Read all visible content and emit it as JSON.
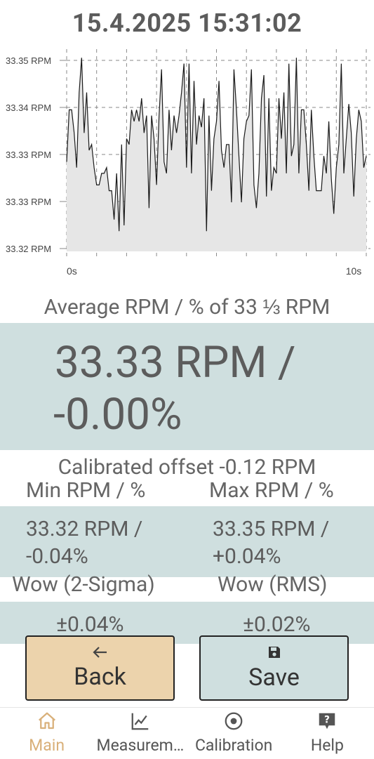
{
  "header": {
    "timestamp": "15.4.2025 15:31:02"
  },
  "chart_data": {
    "type": "area",
    "title": "",
    "xlabel": "",
    "ylabel": "",
    "x_tick_labels": [
      "0s",
      "10s"
    ],
    "xlim": [
      0,
      10
    ],
    "y_tick_labels": [
      "33.35 RPM",
      "33.34 RPM",
      "33.33 RPM",
      "33.33 RPM",
      "33.32 RPM"
    ],
    "ylim": [
      33.3165,
      33.3515
    ],
    "grid": true,
    "colors": {
      "line": "#1a1a1a",
      "fill": "#e6e6e6",
      "grid": "#8a8a8a"
    },
    "series": [
      {
        "values": [
          33.332,
          33.341,
          33.341,
          33.337,
          33.331,
          33.344,
          33.35,
          33.337,
          33.344,
          33.334,
          33.335,
          33.331,
          33.328,
          33.328,
          33.33,
          33.33,
          33.331,
          33.327,
          33.327,
          33.322,
          33.33,
          33.32,
          33.335,
          33.321,
          33.336,
          33.335,
          33.341,
          33.339,
          33.341,
          33.339,
          33.343,
          33.337,
          33.34,
          33.324,
          33.34,
          33.336,
          33.328,
          33.34,
          33.348,
          33.332,
          33.33,
          33.341,
          33.334,
          33.34,
          33.337,
          33.34,
          33.344,
          33.349,
          33.331,
          33.349,
          33.33,
          33.346,
          33.335,
          33.34,
          33.338,
          33.343,
          33.32,
          33.34,
          33.327,
          33.336,
          33.339,
          33.346,
          33.334,
          33.331,
          33.335,
          33.335,
          33.325,
          33.348,
          33.341,
          33.333,
          33.325,
          33.336,
          33.339,
          33.34,
          33.348,
          33.328,
          33.324,
          33.33,
          33.343,
          33.347,
          33.326,
          33.343,
          33.327,
          33.331,
          33.33,
          33.343,
          33.336,
          33.344,
          33.33,
          33.349,
          33.333,
          33.335,
          33.35,
          33.33,
          33.341,
          33.341,
          33.335,
          33.327,
          33.341,
          33.333,
          33.327,
          33.327,
          33.327,
          33.333,
          33.33,
          33.339,
          33.329,
          33.323,
          33.331,
          33.335,
          33.349,
          33.33,
          33.336,
          33.342,
          33.337,
          33.326,
          33.336,
          33.341,
          33.339,
          33.331,
          33.333
        ]
      }
    ]
  },
  "average": {
    "label": "Average RPM / % of 33 ⅓ RPM",
    "value_line1": "33.33 RPM /",
    "value_line2": "-0.00%"
  },
  "calibrated": {
    "label": "Calibrated offset  -0.12 RPM"
  },
  "minmax": {
    "min_label": "Min RPM / %",
    "max_label": "Max RPM / %",
    "min_line1": "33.32 RPM /",
    "min_line2": "-0.04%",
    "max_line1": "33.35 RPM /",
    "max_line2": "+0.04%"
  },
  "wow": {
    "sigma_label": "Wow (2-Sigma)",
    "rms_label": "Wow (RMS)",
    "sigma_value": "±0.04%",
    "rms_value": "±0.02%"
  },
  "buttons": {
    "back_label": "Back",
    "back_color": "#ecd3ac",
    "save_label": "Save",
    "save_color": "#cfdfdf"
  },
  "nav": {
    "items": [
      {
        "label": "Main",
        "icon": "home-icon",
        "active": true
      },
      {
        "label": "Measurem…",
        "icon": "chart-icon",
        "active": false
      },
      {
        "label": "Calibration",
        "icon": "target-icon",
        "active": false
      },
      {
        "label": "Help",
        "icon": "help-icon",
        "active": false
      }
    ],
    "active_color": "#d9b07a"
  }
}
